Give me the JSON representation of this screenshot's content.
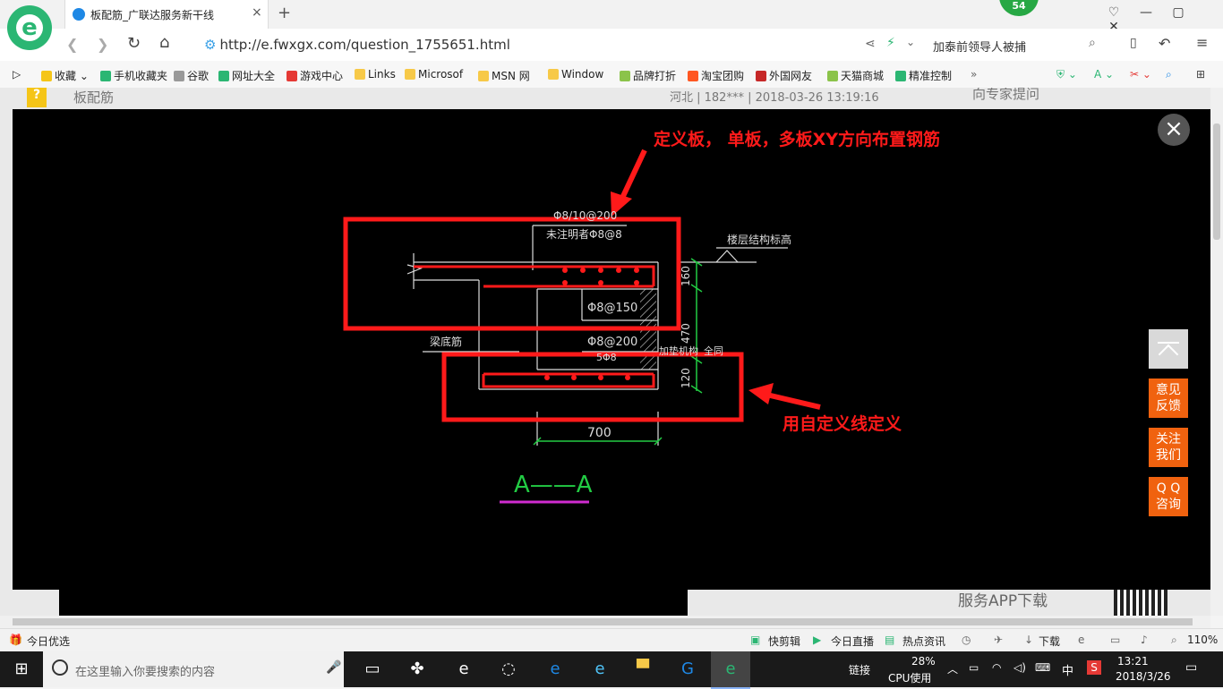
{
  "browser": {
    "tab_title": "板配筋_广联达服务新干线",
    "tab_close": "×",
    "new_tab": "+",
    "badge": "54",
    "url": "http://e.fwxgx.com/question_1755651.html",
    "search_text": "加泰前领导人被捕"
  },
  "bookmarks": [
    {
      "label": "收藏",
      "color": "#f5c518"
    },
    {
      "label": "手机收藏夹",
      "color": "#2bb673"
    },
    {
      "label": "谷歌",
      "color": "#999999"
    },
    {
      "label": "网址大全",
      "color": "#2bb673"
    },
    {
      "label": "游戏中心",
      "color": "#e53935"
    },
    {
      "label": "Links",
      "color": "#f7c948"
    },
    {
      "label": "Microsof",
      "color": "#f7c948"
    },
    {
      "label": "MSN 网",
      "color": "#f7c948"
    },
    {
      "label": "Window",
      "color": "#f7c948"
    },
    {
      "label": "品牌打折",
      "color": "#8bc34a"
    },
    {
      "label": "淘宝团购",
      "color": "#ff5722"
    },
    {
      "label": "外国网友",
      "color": "#c62828"
    },
    {
      "label": "天猫商城",
      "color": "#8bc34a"
    },
    {
      "label": "精准控制",
      "color": "#2bb673"
    }
  ],
  "page": {
    "question_title": "板配筋",
    "meta": "河北 | 182*** | 2018-03-26 13:19:16",
    "expert_link": "向专家提问",
    "app_download": "服务APP下载"
  },
  "drawing": {
    "annotation_top": "定义板， 单板，多板XY方向布置钢筋",
    "annotation_bottom": "用自定义线定义",
    "label_top_rebar": "Φ8/10@200",
    "label_unmarked": "未注明者Φ8@8",
    "label_floor": "楼层结构标高",
    "label_150": "Φ8@150",
    "label_200": "Φ8@200",
    "label_beam": "梁底筋",
    "label_chair": "加垫机构",
    "label_all": "全同",
    "label_b": "5Φ8",
    "dim_160": "160",
    "dim_470": "470",
    "dim_120": "120",
    "dim_700": "700",
    "section": "A——A"
  },
  "side_buttons": [
    {
      "label1": "意见",
      "label2": "反馈"
    },
    {
      "label1": "关注",
      "label2": "我们"
    },
    {
      "label1": "Q Q",
      "label2": "咨询"
    }
  ],
  "status": {
    "left": "今日优选",
    "quick_edit": "快剪辑",
    "live": "今日直播",
    "news": "热点资讯",
    "download": "下载",
    "zoom": "110%"
  },
  "taskbar": {
    "search_placeholder": "在这里输入你要搜索的内容",
    "link": "链接",
    "cpu_pct": "28%",
    "cpu_label": "CPU使用",
    "ime": "中",
    "time": "13:21",
    "date": "2018/3/26"
  },
  "colors": {
    "accent_red": "#ff1a1a",
    "side_orange": "#f0620f",
    "cad_green": "#22cc44"
  }
}
